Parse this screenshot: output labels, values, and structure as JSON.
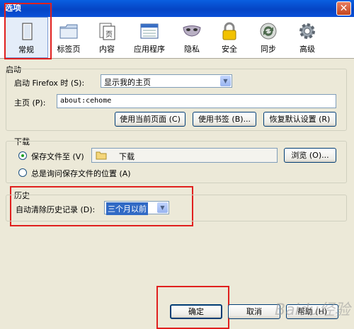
{
  "window": {
    "title": "选项",
    "close_glyph": "✕"
  },
  "toolbar": {
    "items": [
      {
        "label": "常规",
        "icon": "general-page-icon",
        "selected": true
      },
      {
        "label": "标签页",
        "icon": "tabs-folder-icon"
      },
      {
        "label": "内容",
        "icon": "content-page-icon"
      },
      {
        "label": "应用程序",
        "icon": "applications-window-icon"
      },
      {
        "label": "隐私",
        "icon": "privacy-mask-icon"
      },
      {
        "label": "安全",
        "icon": "security-lock-icon"
      },
      {
        "label": "同步",
        "icon": "sync-arrows-icon"
      },
      {
        "label": "高级",
        "icon": "advanced-gear-icon"
      }
    ]
  },
  "startup": {
    "group_label": "启动",
    "when_label": "启动 Firefox 时 (S):",
    "when_value": "显示我的主页",
    "homepage_label": "主页 (P):",
    "homepage_value": "about:cehome",
    "use_current_btn": "使用当前页面 (C)",
    "use_bookmark_btn": "使用书签 (B)...",
    "restore_default_btn": "恢复默认设置 (R)"
  },
  "downloads": {
    "group_label": "下载",
    "save_to_label": "保存文件至 (V)",
    "folder_value": "下载",
    "browse_btn": "浏览 (O)...",
    "ask_label": "总是询问保存文件的位置 (A)"
  },
  "history": {
    "group_label": "历史",
    "auto_clear_label": "自动清除历史记录 (D):",
    "auto_clear_value": "三个月以前"
  },
  "footer": {
    "ok_btn": "确定",
    "cancel_btn": "取消",
    "help_btn": "帮助 (H)"
  },
  "watermark": "Baidu经验",
  "colors": {
    "annotation_red": "#E0201E",
    "title_bar_blue": "#0545C5",
    "selection_blue": "#316AC5"
  }
}
